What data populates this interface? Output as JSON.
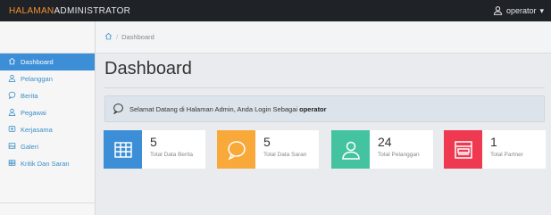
{
  "topbar": {
    "brand_part1": "HALAMAN",
    "brand_part2": "ADMINISTRATOR",
    "user_label": "operator",
    "caret": "▾"
  },
  "sidebar": {
    "items": [
      {
        "label": "Dashboard",
        "icon": "home-icon",
        "active": true
      },
      {
        "label": "Pelanggan",
        "icon": "user-icon"
      },
      {
        "label": "Berita",
        "icon": "chat-bubble-icon"
      },
      {
        "label": "Pegawai",
        "icon": "user-icon"
      },
      {
        "label": "Kerjasama",
        "icon": "handshake-icon"
      },
      {
        "label": "Galeri",
        "icon": "image-icon"
      },
      {
        "label": "Kritik Dan Saran",
        "icon": "table-icon"
      }
    ]
  },
  "breadcrumb": {
    "separator": "/",
    "current": "Dashboard"
  },
  "main": {
    "title": "Dashboard",
    "welcome_text": "Selamat Datang di Halaman Admin, Anda Login Sebagai",
    "welcome_user": "operator"
  },
  "cards": [
    {
      "value": "5",
      "label": "Total Data Berita",
      "color": "#3c8ed6",
      "icon": "table-grid-icon"
    },
    {
      "value": "5",
      "label": "Total Data Saran",
      "color": "#f9a83a",
      "icon": "chat-bubble-icon"
    },
    {
      "value": "24",
      "label": "Total Pelanggan",
      "color": "#44c3a0",
      "icon": "user-icon"
    },
    {
      "value": "1",
      "label": "Total Partner",
      "color": "#ee3950",
      "icon": "browser-window-icon"
    }
  ],
  "colors": {
    "topbar_bg": "#1f2328",
    "brand_accent": "#f58f2c",
    "sidebar_active": "#3c8ed6",
    "link": "#3a8fc7"
  }
}
